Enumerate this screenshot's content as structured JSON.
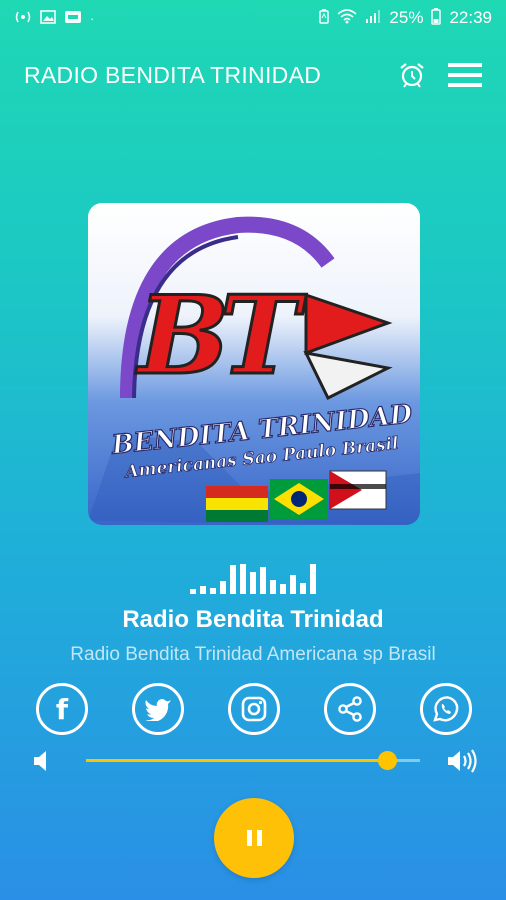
{
  "status_bar": {
    "battery_percent": "25%",
    "time": "22:39",
    "left_icons": [
      "radio-wave-icon",
      "image-icon",
      "notification-icon"
    ],
    "right_icons": [
      "battery-saver-icon",
      "wifi-icon",
      "signal-icon",
      "battery-icon"
    ]
  },
  "app_bar": {
    "title": "RADIO BENDITA TRINIDAD",
    "actions": [
      "alarm-clock-icon",
      "menu-icon"
    ]
  },
  "artwork": {
    "logo_letters": "BT",
    "line1": "BENDITA TRINIDAD",
    "line2": "Americanas Sao Paulo Brasil",
    "flags": [
      "bolivia-flag",
      "brazil-flag",
      "sao-paulo-flag"
    ]
  },
  "player": {
    "station_name": "Radio Bendita Trinidad",
    "station_description": "Radio Bendita Trinidad Americana sp Brasil",
    "equalizer_levels": [
      0.15,
      0.25,
      0.2,
      0.4,
      0.9,
      0.95,
      0.7,
      0.85,
      0.45,
      0.3,
      0.6,
      0.35,
      0.95
    ],
    "volume_level": 0.9,
    "state": "playing"
  },
  "socials": [
    {
      "name": "facebook",
      "icon": "facebook-icon"
    },
    {
      "name": "twitter",
      "icon": "twitter-icon"
    },
    {
      "name": "instagram",
      "icon": "instagram-icon"
    },
    {
      "name": "share",
      "icon": "share-icon"
    },
    {
      "name": "whatsapp",
      "icon": "whatsapp-icon"
    }
  ],
  "colors": {
    "accent": "#ffc107",
    "gradient_top": "#1fd8b4",
    "gradient_bottom": "#2a8fe6"
  }
}
